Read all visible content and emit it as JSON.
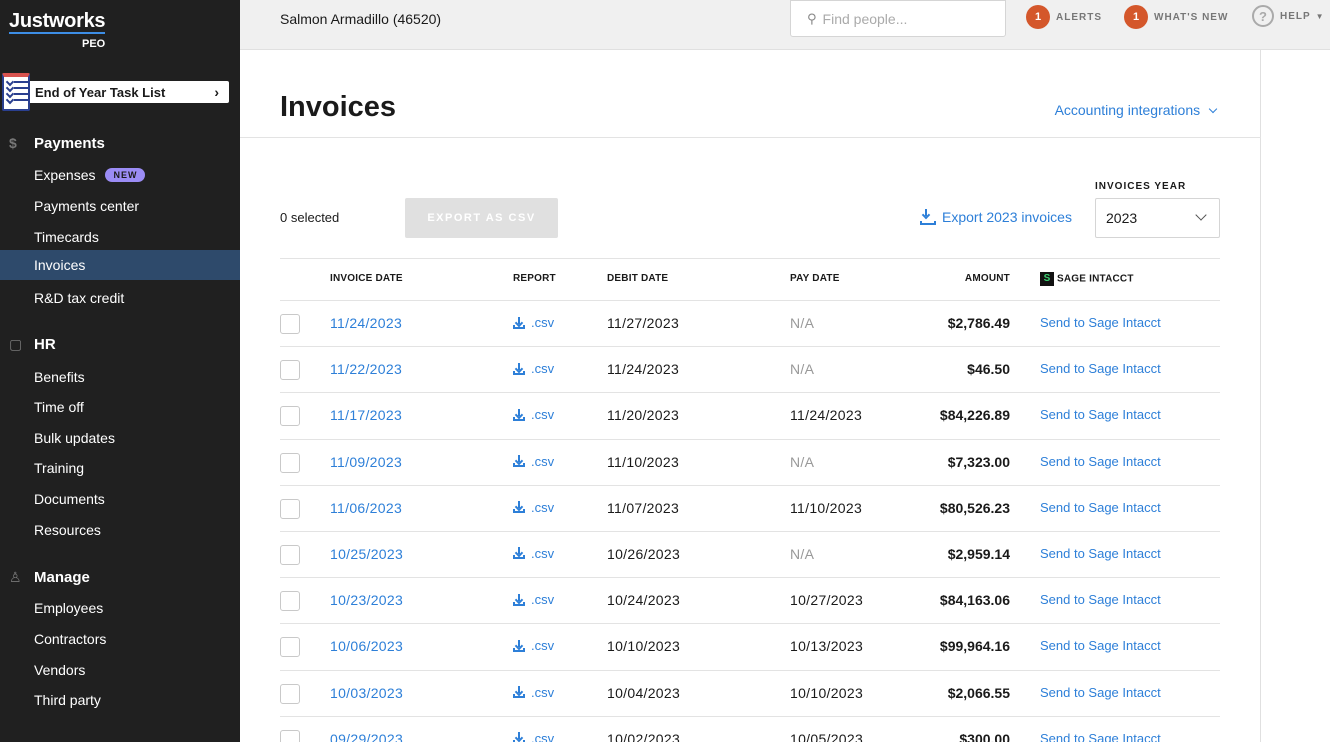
{
  "brand": {
    "name": "Justworks",
    "sub": "PEO"
  },
  "task_list": {
    "label": "End of Year Task List"
  },
  "sidebar": {
    "payments": {
      "title": "Payments",
      "icon": "dollar-icon",
      "items": [
        {
          "label": "Expenses",
          "badge": "NEW"
        },
        {
          "label": "Payments center"
        },
        {
          "label": "Timecards"
        },
        {
          "label": "Invoices",
          "active": true
        },
        {
          "label": "R&D tax credit"
        }
      ]
    },
    "hr": {
      "title": "HR",
      "icon": "clipboard-icon",
      "items": [
        {
          "label": "Benefits"
        },
        {
          "label": "Time off"
        },
        {
          "label": "Bulk updates"
        },
        {
          "label": "Training"
        },
        {
          "label": "Documents"
        },
        {
          "label": "Resources"
        }
      ]
    },
    "manage": {
      "title": "Manage",
      "icon": "people-icon",
      "items": [
        {
          "label": "Employees"
        },
        {
          "label": "Contractors"
        },
        {
          "label": "Vendors"
        },
        {
          "label": "Third party"
        }
      ]
    }
  },
  "topbar": {
    "company": "Salmon Armadillo (46520)",
    "search_placeholder": "Find people...",
    "alerts": {
      "count": "1",
      "label": "ALERTS"
    },
    "whats_new": {
      "count": "1",
      "label": "WHAT'S NEW"
    },
    "help": {
      "label": "HELP"
    }
  },
  "page": {
    "title": "Invoices",
    "accounting_link": "Accounting integrations",
    "selected": "0 selected",
    "export_csv": "EXPORT AS CSV",
    "export_year": "Export 2023 invoices",
    "year_label": "INVOICES YEAR",
    "year_value": "2023"
  },
  "table": {
    "headers": {
      "invoice_date": "INVOICE DATE",
      "report": "REPORT",
      "debit_date": "DEBIT DATE",
      "pay_date": "PAY DATE",
      "amount": "AMOUNT",
      "sage": "SAGE INTACCT"
    },
    "rows": [
      {
        "invoice_date": "11/24/2023",
        "report": ".csv",
        "debit_date": "11/27/2023",
        "pay_date": "N/A",
        "amount": "$2,786.49",
        "action": "Send to Sage Intacct"
      },
      {
        "invoice_date": "11/22/2023",
        "report": ".csv",
        "debit_date": "11/24/2023",
        "pay_date": "N/A",
        "amount": "$46.50",
        "action": "Send to Sage Intacct"
      },
      {
        "invoice_date": "11/17/2023",
        "report": ".csv",
        "debit_date": "11/20/2023",
        "pay_date": "11/24/2023",
        "amount": "$84,226.89",
        "action": "Send to Sage Intacct"
      },
      {
        "invoice_date": "11/09/2023",
        "report": ".csv",
        "debit_date": "11/10/2023",
        "pay_date": "N/A",
        "amount": "$7,323.00",
        "action": "Send to Sage Intacct"
      },
      {
        "invoice_date": "11/06/2023",
        "report": ".csv",
        "debit_date": "11/07/2023",
        "pay_date": "11/10/2023",
        "amount": "$80,526.23",
        "action": "Send to Sage Intacct"
      },
      {
        "invoice_date": "10/25/2023",
        "report": ".csv",
        "debit_date": "10/26/2023",
        "pay_date": "N/A",
        "amount": "$2,959.14",
        "action": "Send to Sage Intacct"
      },
      {
        "invoice_date": "10/23/2023",
        "report": ".csv",
        "debit_date": "10/24/2023",
        "pay_date": "10/27/2023",
        "amount": "$84,163.06",
        "action": "Send to Sage Intacct"
      },
      {
        "invoice_date": "10/06/2023",
        "report": ".csv",
        "debit_date": "10/10/2023",
        "pay_date": "10/13/2023",
        "amount": "$99,964.16",
        "action": "Send to Sage Intacct"
      },
      {
        "invoice_date": "10/03/2023",
        "report": ".csv",
        "debit_date": "10/04/2023",
        "pay_date": "10/10/2023",
        "amount": "$2,066.55",
        "action": "Send to Sage Intacct"
      },
      {
        "invoice_date": "09/29/2023",
        "report": ".csv",
        "debit_date": "10/02/2023",
        "pay_date": "10/05/2023",
        "amount": "$300.00",
        "action": "Send to Sage Intacct"
      }
    ]
  }
}
